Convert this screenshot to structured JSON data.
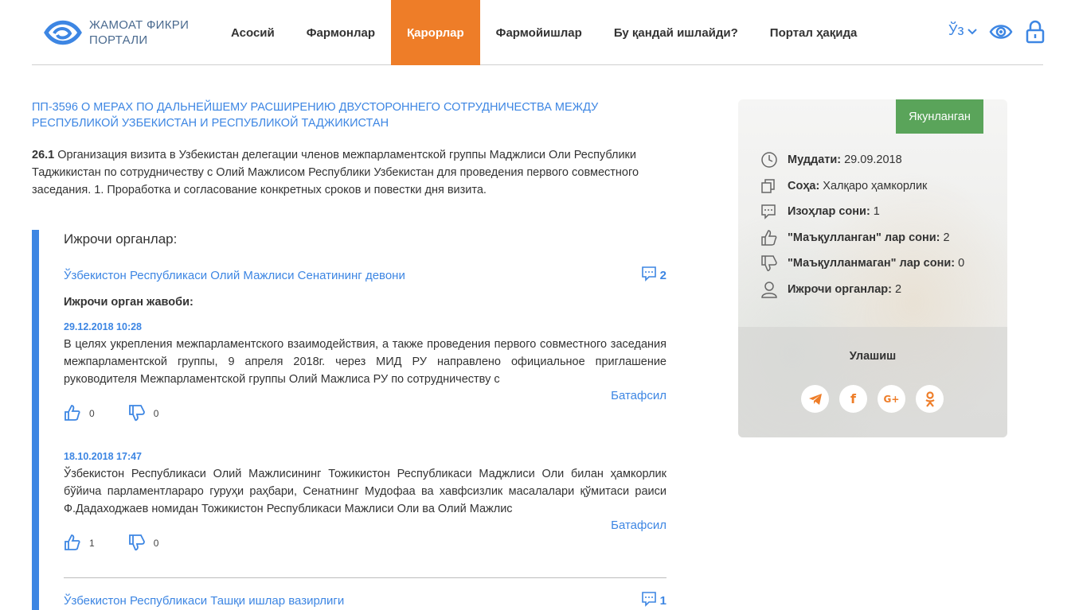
{
  "header": {
    "logo_line1": "ЖАМОАТ ФИКРИ",
    "logo_line2": "ПОРТАЛИ",
    "nav": [
      {
        "label": "Асосий"
      },
      {
        "label": "Фармонлар"
      },
      {
        "label": "Қарорлар",
        "active": true
      },
      {
        "label": "Фармойишлар"
      },
      {
        "label": "Бу қандай ишлайди?"
      },
      {
        "label": "Портал ҳақида"
      }
    ],
    "lang": "Ўз",
    "accent_color": "#3d86e3",
    "active_nav_color": "#ee7d28"
  },
  "main": {
    "title": "ПП-3596 О МЕРАХ ПО ДАЛЬНЕЙШЕМУ РАСШИРЕНИЮ ДВУСТОРОННЕГО СОТРУДНИЧЕСТВА МЕЖДУ РЕСПУБЛИКОЙ УЗБЕКИСТАН И РЕСПУБЛИКОЙ ТАДЖИКИСТАН",
    "item_number": "26.1",
    "description": "Организация визита в Узбекистан делегации членов межпарламентской группы Маджлиси Оли Республики Таджикистан по сотрудничеству с Олий Мажлисом Республики Узбекистан для проведения первого совместного заседания. 1. Проработка и согласование конкретных сроков и повестки дня визита.",
    "executors_heading": "Ижрочи органлар:",
    "executors": [
      {
        "name": "Ўзбекистон Республикаси Олий Мажлиси Сенатининг девони",
        "comments": "2",
        "answer_label": "Ижрочи орган жавоби:",
        "answers": [
          {
            "date": "29.12.2018 10:28",
            "text": "В целях укрепления межпарламентского взаимодействия, а также проведения первого совместного заседания межпарламентской группы, 9 апреля 2018г. через МИД РУ направлено официальное приглашение руководителя Межпарламентской группы Олий Мажлиса РУ по сотрудничеству с",
            "more": "Батафсил",
            "likes": "0",
            "dislikes": "0"
          },
          {
            "date": "18.10.2018 17:47",
            "text": "Ўзбекистон Республикаси Олий Мажлисининг Тожикистон Республикаси Маджлиси Оли билан ҳамкорлик бўйича парламентлараро гуруҳи раҳбари, Сенатнинг Мудофаа ва хавфсизлик масалалари қўмитаси раиси Ф.Дадаходжаев номидан Тожикистон Республикаси Мажлиси Оли ва Олий Мажлис",
            "more": "Батафсил",
            "likes": "1",
            "dislikes": "0"
          }
        ]
      },
      {
        "name": "Ўзбекистон Республикаси Ташқи ишлар вазирлиги",
        "comments": "1"
      }
    ]
  },
  "sidebar": {
    "status": "Якунланган",
    "status_color": "#5aa45a",
    "info": [
      {
        "icon": "clock-icon",
        "label": "Муддати:",
        "value": "29.09.2018"
      },
      {
        "icon": "copy-icon",
        "label": "Соҳа:",
        "value": "Халқаро ҳамкорлик"
      },
      {
        "icon": "comment-icon",
        "label": "Изоҳлар сони:",
        "value": "1"
      },
      {
        "icon": "thumbs-up-icon",
        "label": "\"Маъқулланган\" лар сони:",
        "value": "2"
      },
      {
        "icon": "thumbs-down-icon",
        "label": "\"Маъқулланмаган\" лар сони:",
        "value": "0"
      },
      {
        "icon": "user-icon",
        "label": "Ижрочи органлар:",
        "value": "2"
      }
    ],
    "share_label": "Улашиш",
    "share": [
      {
        "icon": "telegram-icon"
      },
      {
        "icon": "facebook-icon",
        "glyph": "f"
      },
      {
        "icon": "google-plus-icon",
        "glyph": "G+"
      },
      {
        "icon": "odnoklassniki-icon"
      }
    ]
  }
}
